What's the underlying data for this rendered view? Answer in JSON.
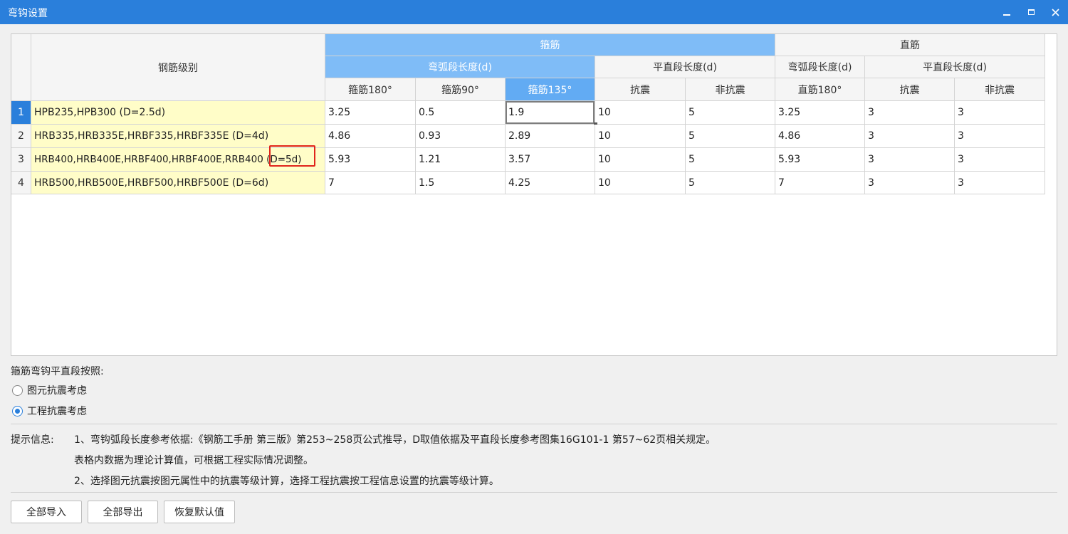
{
  "window": {
    "title": "弯钩设置"
  },
  "table": {
    "headers": {
      "grade": "钢筋级别",
      "stirrup": "箍筋",
      "straight": "直筋",
      "arc_length": "弯弧段长度(d)",
      "flat_length": "平直段长度(d)",
      "arc_length_2": "弯弧段长度(d)",
      "flat_length_2": "平直段长度(d)",
      "s180": "箍筋180°",
      "s90": "箍筋90°",
      "s135": "箍筋135°",
      "seismic": "抗震",
      "nonseismic": "非抗震",
      "z180": "直筋180°",
      "seismic_2": "抗震",
      "nonseismic_2": "非抗震"
    },
    "rows": [
      {
        "num": "1",
        "grade": "HPB235,HPB300 (D=2.5d)",
        "s180": "3.25",
        "s90": "0.5",
        "s135": "1.9",
        "seismic": "10",
        "nonseismic": "5",
        "z180": "3.25",
        "zseismic": "3",
        "znonseismic": "3"
      },
      {
        "num": "2",
        "grade": "HRB335,HRB335E,HRBF335,HRBF335E (D=4d)",
        "s180": "4.86",
        "s90": "0.93",
        "s135": "2.89",
        "seismic": "10",
        "nonseismic": "5",
        "z180": "4.86",
        "zseismic": "3",
        "znonseismic": "3"
      },
      {
        "num": "3",
        "grade": "HRB400,HRB400E,HRBF400,HRBF400E,RRB400 (D=5d)",
        "s180": "5.93",
        "s90": "1.21",
        "s135": "3.57",
        "seismic": "10",
        "nonseismic": "5",
        "z180": "5.93",
        "zseismic": "3",
        "znonseismic": "3"
      },
      {
        "num": "4",
        "grade": "HRB500,HRB500E,HRBF500,HRBF500E (D=6d)",
        "s180": "7",
        "s90": "1.5",
        "s135": "4.25",
        "seismic": "10",
        "nonseismic": "5",
        "z180": "7",
        "zseismic": "3",
        "znonseismic": "3"
      }
    ]
  },
  "options": {
    "title": "箍筋弯钩平直段按照:",
    "radio1": "图元抗震考虑",
    "radio2": "工程抗震考虑",
    "selected": "工程抗震考虑"
  },
  "info": {
    "label": "提示信息:",
    "line1": "1、弯钩弧段长度参考依据:《钢筋工手册 第三版》第253~258页公式推导，D取值依据及平直段长度参考图集16G101-1 第57~62页相关规定。",
    "line2": "表格内数据为理论计算值，可根据工程实际情况调整。",
    "line3": "2、选择图元抗震按图元属性中的抗震等级计算，选择工程抗震按工程信息设置的抗震等级计算。"
  },
  "buttons": {
    "import_all": "全部导入",
    "export_all": "全部导出",
    "restore_default": "恢复默认值"
  },
  "colors": {
    "titlebar": "#2a7fdb",
    "header_blue": "#7fbcf7",
    "selected_header": "#62abf3",
    "grade_bg": "#fffdc8",
    "highlight_box": "#e0241b"
  }
}
